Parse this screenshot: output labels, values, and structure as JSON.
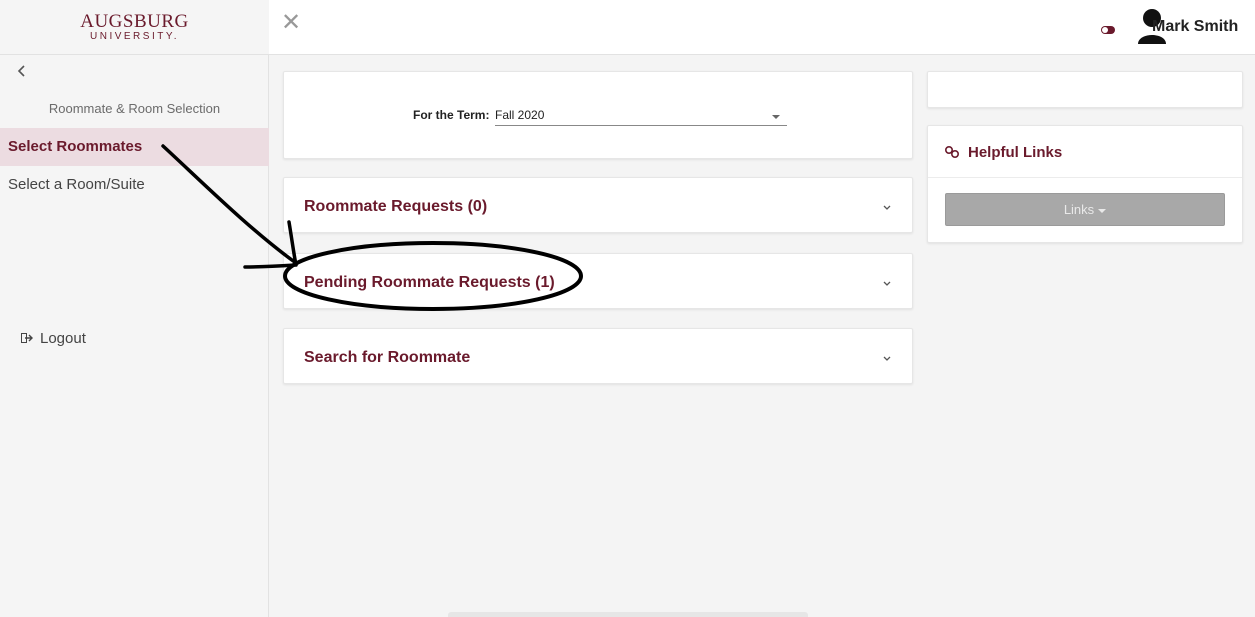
{
  "app": {
    "logo_main": "AUGSBURG",
    "logo_sub": "UNIVERSITY.",
    "brand_color": "#6a1a2c"
  },
  "sidebar": {
    "back_icon": "chevron-left-icon",
    "section_title": "Roommate & Room Selection",
    "items": [
      {
        "label": "Select Roommates",
        "active": true
      },
      {
        "label": "Select a Room/Suite",
        "active": false
      }
    ],
    "logout_label": "Logout",
    "logout_icon": "sign-out-icon"
  },
  "topbar": {
    "close_icon": "close-icon",
    "toggle_icon": "toggle-icon",
    "user_icon": "user-icon",
    "user_name": "Mark Smith"
  },
  "term": {
    "label": "For the Term:",
    "selected": "Fall 2020"
  },
  "accordions": [
    {
      "title": "Roommate Requests (0)"
    },
    {
      "title": "Pending Roommate Requests (1)"
    },
    {
      "title": "Search for Roommate"
    }
  ],
  "helpful_links": {
    "title": "Helpful Links",
    "icon": "link-icon",
    "button_label": "Links"
  }
}
